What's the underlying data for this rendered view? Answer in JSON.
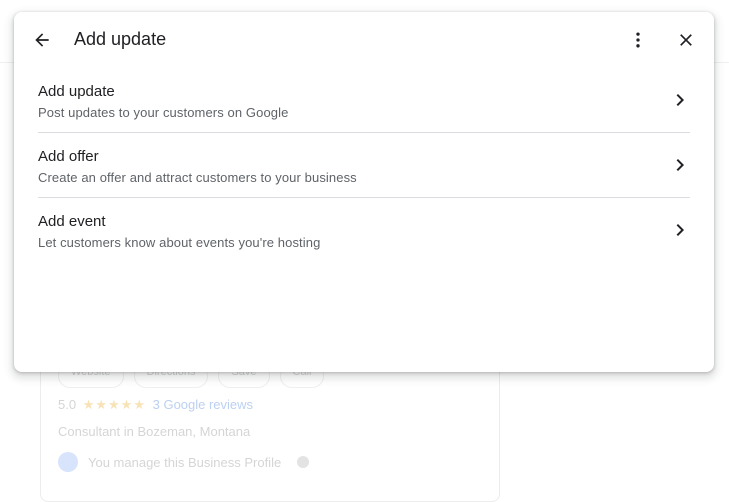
{
  "background": {
    "actions": [
      "Website",
      "Directions",
      "Save",
      "Call"
    ],
    "rating": "5.0",
    "stars": "★★★★★",
    "reviews": "3 Google reviews",
    "category": "Consultant in Bozeman, Montana",
    "manage_text": "You manage this Business Profile"
  },
  "dialog": {
    "title": "Add update",
    "icons": {
      "back": "arrow-back-icon",
      "more": "more-vert-icon",
      "close": "close-icon"
    },
    "items": [
      {
        "title": "Add update",
        "description": "Post updates to your customers on Google"
      },
      {
        "title": "Add offer",
        "description": "Create an offer and attract customers to your business"
      },
      {
        "title": "Add event",
        "description": "Let customers know about events you're hosting"
      }
    ]
  },
  "colors": {
    "text_primary": "#202124",
    "text_secondary": "#5f6368",
    "divider": "#dadce0"
  }
}
